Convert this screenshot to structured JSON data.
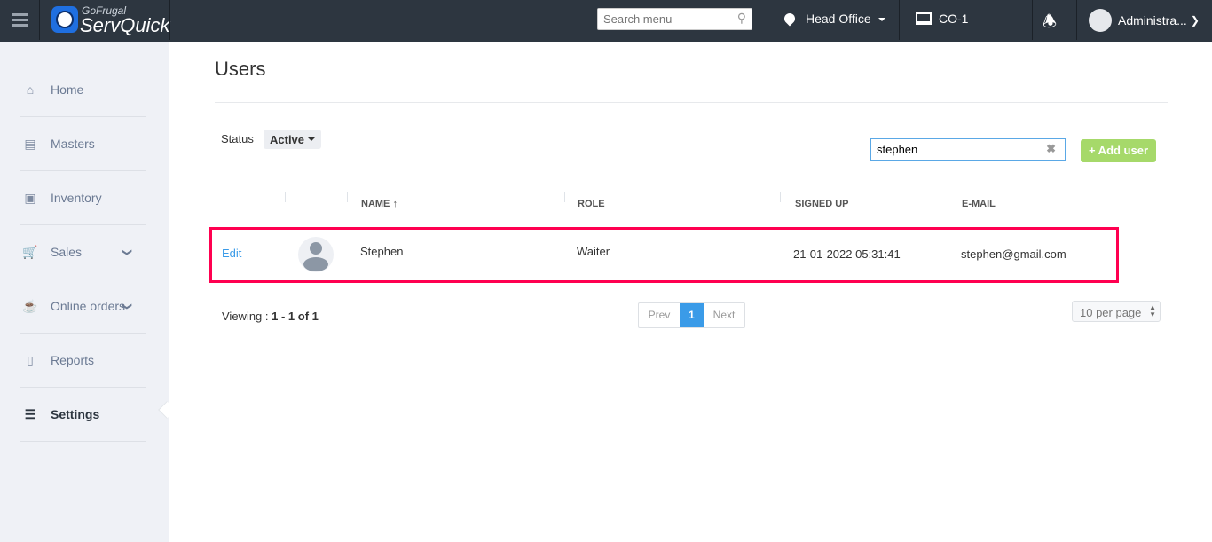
{
  "header": {
    "brand_top": "GoFrugal",
    "brand_main": "ServQuick",
    "search_placeholder": "Search menu",
    "location": "Head Office",
    "terminal": "CO-1",
    "user": "Administra..."
  },
  "sidebar": {
    "items": [
      {
        "label": "Home"
      },
      {
        "label": "Masters"
      },
      {
        "label": "Inventory"
      },
      {
        "label": "Sales"
      },
      {
        "label": "Online orders"
      },
      {
        "label": "Reports"
      },
      {
        "label": "Settings"
      }
    ]
  },
  "page": {
    "title": "Users",
    "status_label": "Status",
    "status_value": "Active",
    "search_value": "stephen",
    "add_user": "+ Add user"
  },
  "table": {
    "headers": [
      "NAME",
      "ROLE",
      "SIGNED UP",
      "E-MAIL"
    ],
    "sort_indicator": "↑",
    "rows": [
      {
        "action": "Edit",
        "name": "Stephen",
        "role": "Waiter",
        "signed_up": "21-01-2022 05:31:41",
        "email": "stephen@gmail.com"
      }
    ]
  },
  "pagination": {
    "viewing_label": "Viewing : ",
    "viewing_range": "1 - 1 of 1",
    "prev": "Prev",
    "current": "1",
    "next": "Next",
    "per_page": "10 per page"
  },
  "colors": {
    "header_bg": "#2d3640",
    "accent": "#3a9be8",
    "add_button": "#a6d96a",
    "highlight": "#ff0050"
  }
}
